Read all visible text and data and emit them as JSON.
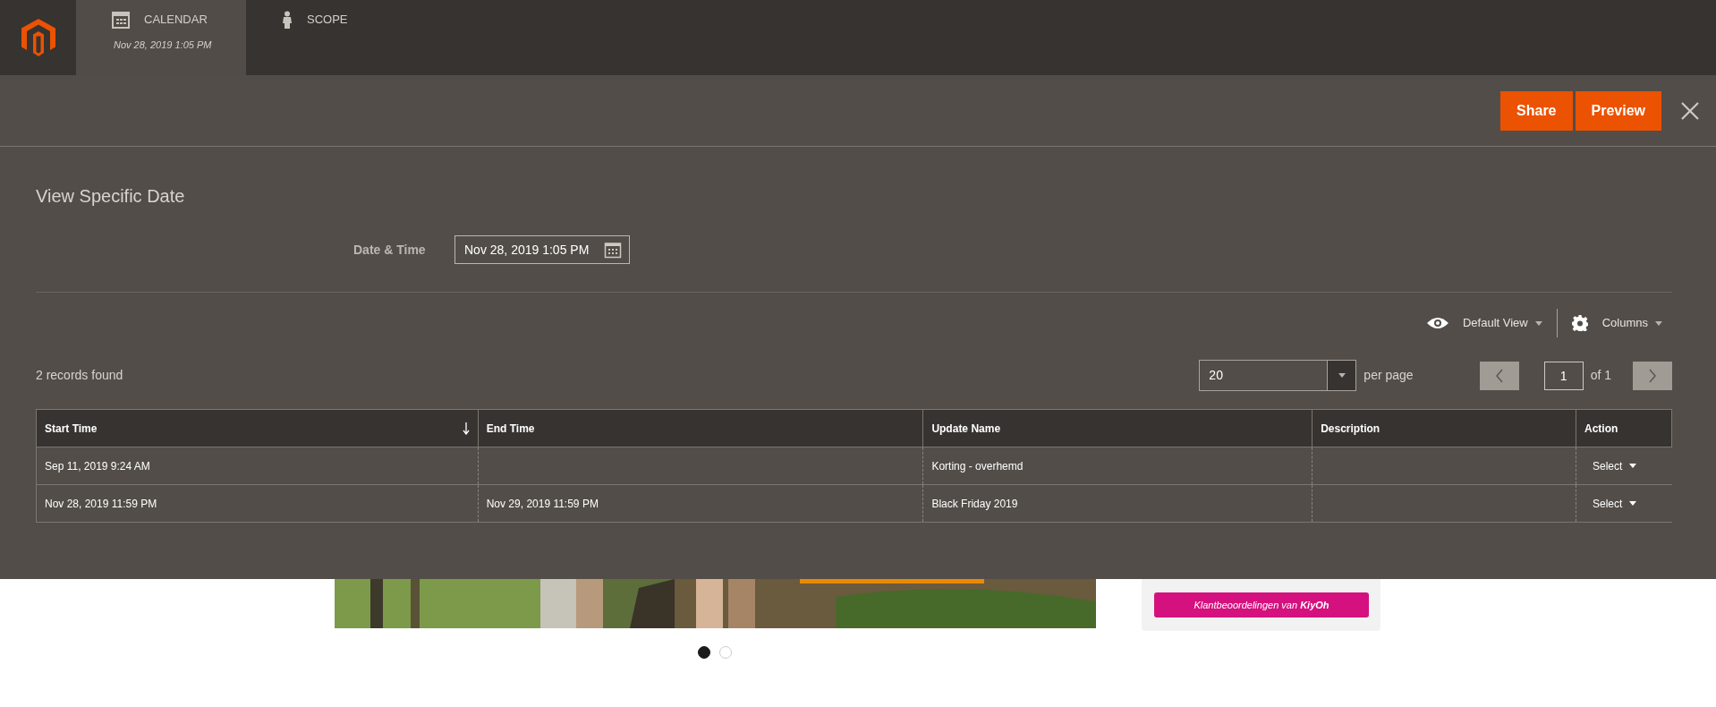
{
  "header": {
    "tabs": [
      {
        "kind": "calendar",
        "label": "CALENDAR",
        "sublabel": "Nov 28, 2019 1:05 PM",
        "selected": true
      },
      {
        "kind": "scope",
        "label": "SCOPE",
        "selected": false
      }
    ]
  },
  "actions": [
    "Share",
    "Preview"
  ],
  "title": "View Specific Date",
  "date_field": {
    "label": "Date & Time",
    "value": "Nov 28, 2019 1:05 PM"
  },
  "toolbar": {
    "view": "Default View",
    "columns": "Columns"
  },
  "records": "2 records found",
  "pager": {
    "per_page": "20",
    "per_page_label": "per page",
    "page": "1",
    "of": "of 1"
  },
  "table": {
    "columns": [
      {
        "label": "Start Time",
        "sorted": true
      },
      {
        "label": "End Time",
        "sorted": false
      },
      {
        "label": "Update Name",
        "sorted": false
      },
      {
        "label": "Description",
        "sorted": false
      },
      {
        "label": "Action",
        "sorted": false
      }
    ],
    "rows": [
      {
        "start": "Sep 11, 2019 9:24 AM",
        "name": "Korting - overhemd",
        "action": "Select"
      },
      {
        "start": "Nov 28, 2019 11:59 PM",
        "end": "Nov 29, 2019 11:59 PM",
        "name": "Black Friday 2019",
        "action": "Select"
      }
    ]
  },
  "background": {
    "carousel_dots": [
      {
        "selected": true
      },
      {
        "selected": false
      }
    ],
    "review_button": "Klantbeoordelingen van **KiyOh**"
  }
}
